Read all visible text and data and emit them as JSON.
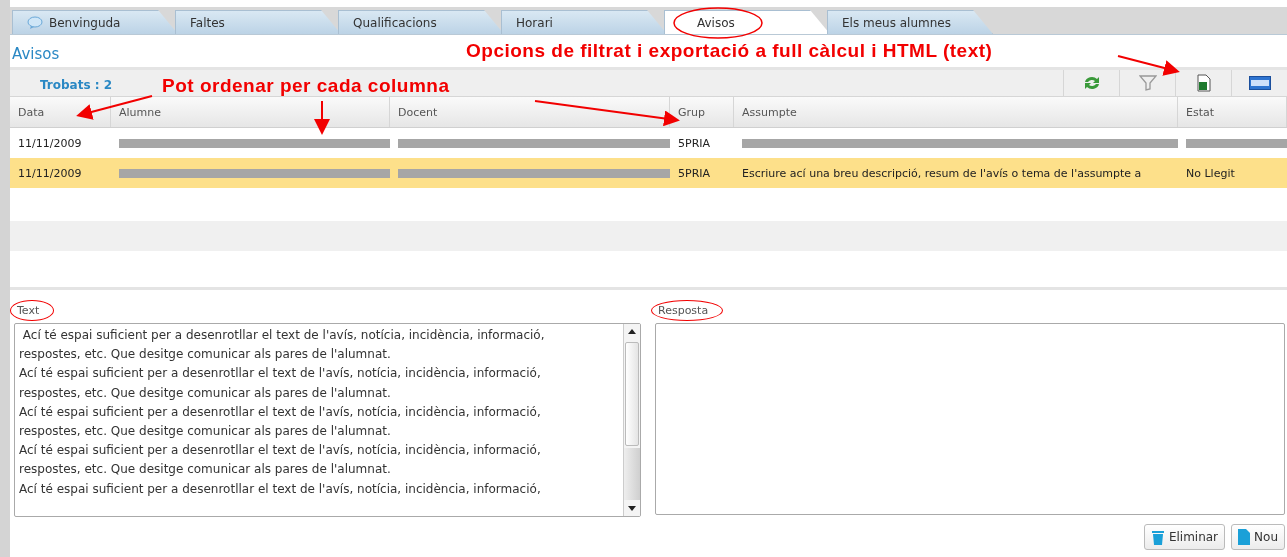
{
  "tabs": [
    {
      "label": "Benvinguda",
      "selected": false,
      "icon": true
    },
    {
      "label": "Faltes",
      "selected": false
    },
    {
      "label": "Qualificacions",
      "selected": false
    },
    {
      "label": "Horari",
      "selected": false
    },
    {
      "label": "Avisos",
      "selected": true
    },
    {
      "label": "Els meus alumnes",
      "selected": false
    }
  ],
  "page_title": "Avisos",
  "found": "Trobats : 2",
  "toolbar": [
    {
      "kind": "refresh"
    },
    {
      "kind": "filter"
    },
    {
      "kind": "spreadsheet"
    },
    {
      "kind": "html"
    }
  ],
  "table": {
    "columns": [
      "Data",
      "Alumne",
      "Docent",
      "Grup",
      "Assumpte",
      "Estat"
    ],
    "rows": [
      {
        "selected": false,
        "cells": [
          {
            "kind": "text",
            "text": "11/11/2009"
          },
          {
            "kind": "redacted"
          },
          {
            "kind": "redacted"
          },
          {
            "kind": "text",
            "text": "5PRIA"
          },
          {
            "kind": "redacted"
          },
          {
            "kind": "redacted"
          }
        ]
      },
      {
        "selected": true,
        "cells": [
          {
            "kind": "text",
            "text": "11/11/2009"
          },
          {
            "kind": "redacted"
          },
          {
            "kind": "redacted"
          },
          {
            "kind": "text",
            "text": "5PRIA"
          },
          {
            "kind": "text",
            "text": "Escriure ací una breu descripció, resum de l'avís o tema de l'assumpte a"
          },
          {
            "kind": "text",
            "text": "No Llegit"
          }
        ]
      }
    ]
  },
  "text_panel": {
    "label": "Text",
    "lines": [
      " Ací té espai suficient per a desenrotllar el text de l'avís, notícia, incidència, informació,",
      "respostes, etc. Que desitge comunicar als pares de l'alumnat.",
      "Ací té espai suficient per a desenrotllar el text de l'avís, notícia, incidència, informació,",
      "respostes, etc. Que desitge comunicar als pares de l'alumnat.",
      "Ací té espai suficient per a desenrotllar el text de l'avís, notícia, incidència, informació,",
      "respostes, etc. Que desitge comunicar als pares de l'alumnat.",
      "Ací té espai suficient per a desenrotllar el text de l'avís, notícia, incidència, informació,",
      "respostes, etc. Que desitge comunicar als pares de l'alumnat.",
      "Ací té espai suficient per a desenrotllar el text de l'avís, notícia, incidència, informació,"
    ]
  },
  "reply_panel": {
    "label": "Resposta"
  },
  "buttons": [
    {
      "kind": "delete",
      "label": "Eliminar"
    },
    {
      "kind": "new",
      "label": "Nou"
    }
  ],
  "annotations": [
    "Opcions de filtrat i exportació a full càlcul i HTML (text)",
    "Pot ordenar per cada columna"
  ]
}
